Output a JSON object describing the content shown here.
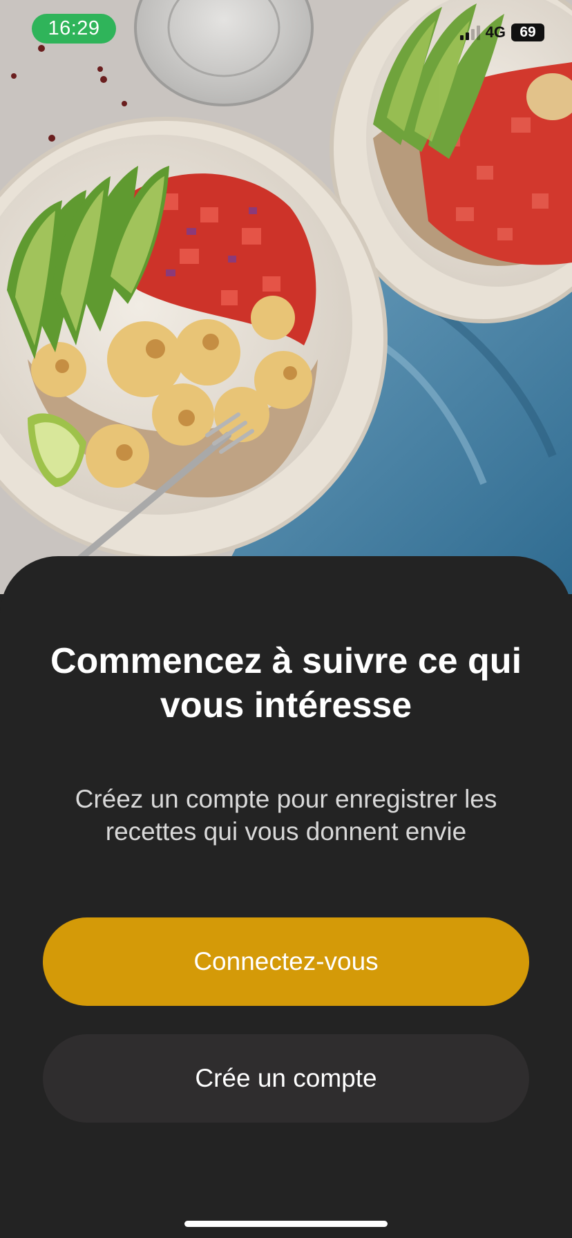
{
  "status_bar": {
    "time": "16:29",
    "network": "4G",
    "battery": "69",
    "time_pill_color": "#2fb45a"
  },
  "hero": {
    "image": "food-bowls-photo"
  },
  "sheet": {
    "title": "Commencez à suivre ce qui vous intéresse",
    "subtitle": "Créez un compte pour enregistrer les recettes qui vous donnent envie"
  },
  "buttons": {
    "login_label": "Connectez-vous",
    "signup_label": "Crée un compte"
  },
  "colors": {
    "accent": "#d49a08",
    "sheet_background": "#232323",
    "secondary_button": "#2f2d2e"
  }
}
